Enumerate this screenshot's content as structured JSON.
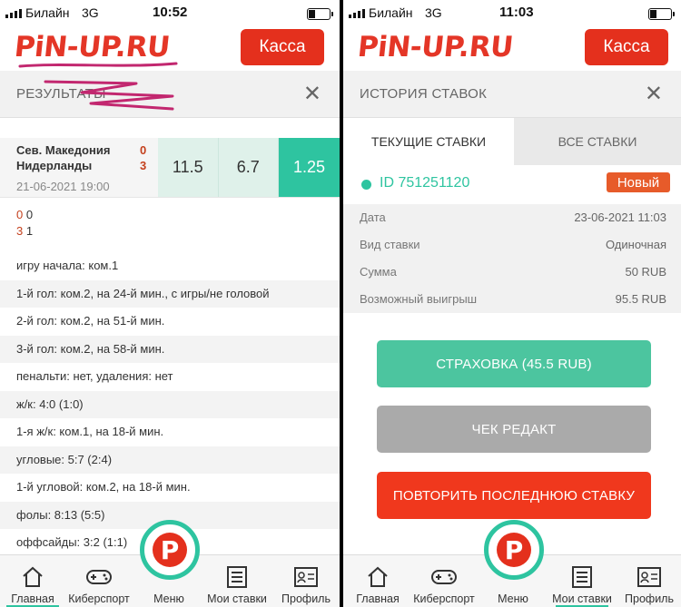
{
  "left": {
    "status": {
      "carrier": "Билайн",
      "network": "3G",
      "time": "10:52"
    },
    "logo": "PiN-UP.RU",
    "cashier_button": "Касса",
    "title": "РЕЗУЛЬТАТЫ",
    "match": {
      "team1": "Сев. Македония",
      "team2": "Нидерланды",
      "score1": "0",
      "score2": "3",
      "date": "21-06-2021 19:00",
      "odds": [
        "11.5",
        "6.7",
        "1.25"
      ]
    },
    "period_scores": [
      [
        "0",
        "0"
      ],
      [
        "3",
        "1"
      ]
    ],
    "results": [
      "игру начала: ком.1",
      "1-й гол: ком.2, на 24-й мин., с игры/не головой",
      "2-й гол: ком.2, на 51-й мин.",
      "3-й гол: ком.2, на 58-й мин.",
      "пенальти: нет, удаления: нет",
      "ж/к: 4:0 (1:0)",
      "1-я ж/к: ком.1, на 18-й мин.",
      "угловые: 5:7 (2:4)",
      "1-й угловой: ком.2, на 18-й мин.",
      "фолы: 8:13 (5:5)",
      "оффсайды: 3:2 (1:1)"
    ],
    "nav": [
      "Главная",
      "Киберспорт",
      "Меню",
      "Мои ставки",
      "Профиль"
    ]
  },
  "right": {
    "status": {
      "carrier": "Билайн",
      "network": "3G",
      "time": "11:03"
    },
    "logo": "PiN-UP.RU",
    "cashier_button": "Касса",
    "title": "ИСТОРИЯ СТАВОК",
    "tabs": [
      "ТЕКУЩИЕ СТАВКИ",
      "ВСЕ СТАВКИ"
    ],
    "bet": {
      "id": "ID 751251120",
      "badge": "Новый",
      "details": [
        {
          "label": "Дата",
          "value": "23-06-2021 11:03"
        },
        {
          "label": "Вид ставки",
          "value": "Одиночная"
        },
        {
          "label": "Сумма",
          "value": "50 RUB"
        },
        {
          "label": "Возможный выигрыш",
          "value": "95.5 RUB"
        }
      ]
    },
    "buttons": {
      "insurance": "СТРАХОВКА (45.5 RUB)",
      "check_edit": "ЧЕК РЕДАКТ",
      "repeat": "ПОВТОРИТЬ ПОСЛЕДНЮЮ СТАВКУ"
    },
    "nav": [
      "Главная",
      "Киберспорт",
      "Меню",
      "Мои ставки",
      "Профиль"
    ]
  },
  "colors": {
    "brand_red": "#e4301d",
    "accent_green": "#2ec4a0",
    "badge_orange": "#e75b2a",
    "scribble_pink": "#c2276f"
  }
}
